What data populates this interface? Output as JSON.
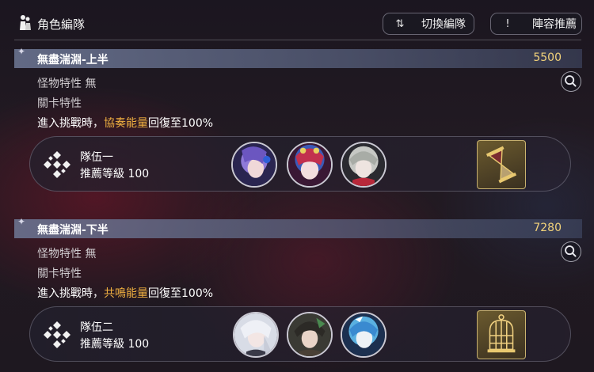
{
  "header": {
    "title": "角色編隊",
    "switch_button": {
      "icon": "switch-arrows-icon",
      "label": "切換編隊"
    },
    "recommend_button": {
      "icon": "exclamation-icon",
      "label": "陣容推薦"
    }
  },
  "sections": [
    {
      "name": "無盡湍淵-上半",
      "score": "5500",
      "monster_label": "怪物特性",
      "monster_value": "無",
      "stage_label": "關卡特性",
      "effect_prefix": "進入挑戰時，",
      "effect_highlight": "協奏能量",
      "effect_suffix": "回復至100%",
      "team": {
        "name": "隊伍一",
        "level_label": "推薦等級",
        "level": "100"
      },
      "avatars": [
        "character-avatar-purple-hair",
        "character-avatar-red-blue-hair",
        "character-avatar-grey-hair"
      ],
      "item_icon": "hourglass-icon"
    },
    {
      "name": "無盡湍淵-下半",
      "score": "7280",
      "monster_label": "怪物特性",
      "monster_value": "無",
      "stage_label": "關卡特性",
      "effect_prefix": "進入挑戰時，",
      "effect_highlight": "共鳴能量",
      "effect_suffix": "回復至100%",
      "team": {
        "name": "隊伍二",
        "level_label": "推薦等級",
        "level": "100"
      },
      "avatars": [
        "character-avatar-white-hair",
        "character-avatar-dark-hair",
        "character-avatar-blue-hair"
      ],
      "item_icon": "birdcage-icon"
    }
  ],
  "colors": {
    "score": "#f1d27a",
    "highlight": "#f0b040",
    "section_bar": "#6e7896"
  }
}
